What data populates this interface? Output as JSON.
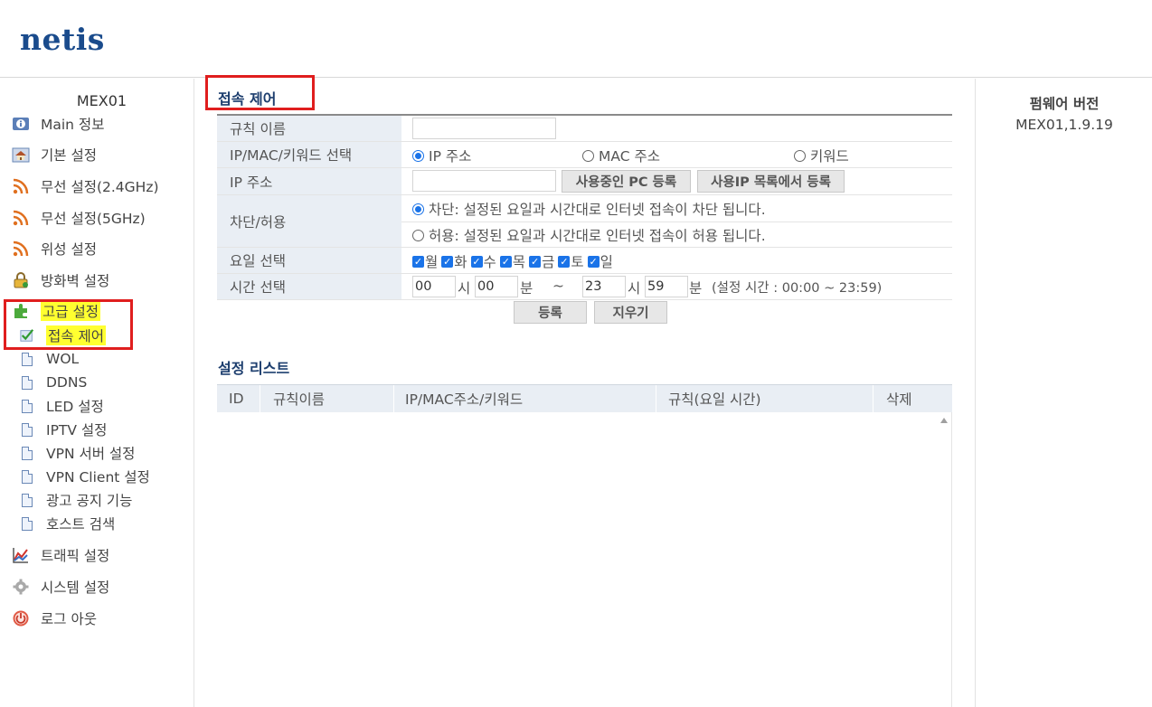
{
  "brand": {
    "logo": "netis"
  },
  "sidebar": {
    "model": "MEX01",
    "items": [
      {
        "label": "Main 정보",
        "icon": "info-icon"
      },
      {
        "label": "기본 설정",
        "icon": "home-icon"
      },
      {
        "label": "무선 설정(2.4GHz)",
        "icon": "wifi-icon"
      },
      {
        "label": "무선 설정(5GHz)",
        "icon": "wifi-icon"
      },
      {
        "label": "위성 설정",
        "icon": "wifi-icon"
      },
      {
        "label": "방화벽 설정",
        "icon": "lock-icon"
      },
      {
        "label": "고급 설정",
        "icon": "puzzle-icon"
      },
      {
        "label": "트래픽 설정",
        "icon": "chart-icon"
      },
      {
        "label": "시스템 설정",
        "icon": "gear-icon"
      },
      {
        "label": "로그 아웃",
        "icon": "power-icon"
      }
    ],
    "sub_items": [
      {
        "label": "접속 제어",
        "icon": "check-icon"
      },
      {
        "label": "WOL",
        "icon": "document-icon"
      },
      {
        "label": "DDNS",
        "icon": "document-icon"
      },
      {
        "label": "LED 설정",
        "icon": "document-icon"
      },
      {
        "label": "IPTV 설정",
        "icon": "document-icon"
      },
      {
        "label": "VPN 서버 설정",
        "icon": "document-icon"
      },
      {
        "label": "VPN Client 설정",
        "icon": "document-icon"
      },
      {
        "label": "광고 공지 기능",
        "icon": "document-icon"
      },
      {
        "label": "호스트 검색",
        "icon": "document-icon"
      }
    ]
  },
  "form": {
    "title": "접속 제어",
    "rule_name": {
      "label": "규칙 이름",
      "value": ""
    },
    "select_type": {
      "label": "IP/MAC/키워드 선택",
      "options": [
        "IP 주소",
        "MAC 주소",
        "키워드"
      ],
      "selected": "IP 주소"
    },
    "ip": {
      "label": "IP 주소",
      "value": "",
      "btn_register_pc": "사용중인 PC 등록",
      "btn_register_list": "사용IP 목록에서 등록"
    },
    "policy": {
      "label": "차단/허용",
      "block": "차단: 설정된 요일과 시간대로 인터넷 접속이 차단 됩니다.",
      "allow": "허용: 설정된 요일과 시간대로 인터넷 접속이 허용 됩니다.",
      "selected": "block"
    },
    "days": {
      "label": "요일 선택",
      "items": [
        "월",
        "화",
        "수",
        "목",
        "금",
        "토",
        "일"
      ],
      "checked": [
        true,
        true,
        true,
        true,
        true,
        true,
        true
      ]
    },
    "time": {
      "label": "시간 선택",
      "start_hour": "00",
      "start_min": "00",
      "end_hour": "23",
      "end_min": "59",
      "hour_unit": "시",
      "min_unit": "분",
      "tilde": "~",
      "note": "(설정 시간 : 00:00 ~ 23:59)"
    },
    "btn_add": "등록",
    "btn_clear": "지우기"
  },
  "list": {
    "title": "설정 리스트",
    "columns": [
      "ID",
      "규칙이름",
      "IP/MAC주소/키워드",
      "규칙(요일 시간)",
      "삭제"
    ],
    "rows": []
  },
  "firmware": {
    "title": "펌웨어 버전",
    "version": "MEX01,1.9.19"
  },
  "colors": {
    "brand": "#1a4b8c",
    "highlight": "#ffff30",
    "annotation_red": "#e01e1e",
    "label_bg": "#e9eef4",
    "accent_blue": "#1a73e8"
  }
}
